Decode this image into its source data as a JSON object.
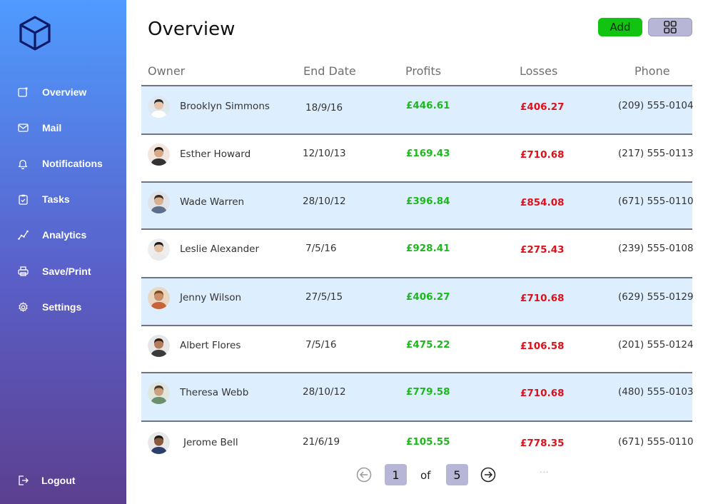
{
  "sidebar": {
    "items": [
      {
        "label": "Overview",
        "icon": "overview-icon"
      },
      {
        "label": "Mail",
        "icon": "mail-icon"
      },
      {
        "label": "Notifications",
        "icon": "bell-icon"
      },
      {
        "label": "Tasks",
        "icon": "clipboard-check-icon"
      },
      {
        "label": "Analytics",
        "icon": "analytics-icon"
      },
      {
        "label": "Save/Print",
        "icon": "printer-icon"
      },
      {
        "label": "Settings",
        "icon": "gear-icon"
      }
    ],
    "logout_label": "Logout"
  },
  "header": {
    "title": "Overview",
    "add_label": "Add"
  },
  "table": {
    "columns": [
      "Owner",
      "End Date",
      "Profits",
      "Losses",
      "Phone"
    ],
    "rows": [
      {
        "owner": "Brooklyn Simmons",
        "end_date": "18/9/16",
        "profit": "£446.61",
        "loss": "£406.27",
        "phone": "(209) 555-0104"
      },
      {
        "owner": "Esther Howard",
        "end_date": "12/10/13",
        "profit": "£169.43",
        "loss": "£710.68",
        "phone": "(217) 555-0113"
      },
      {
        "owner": "Wade Warren",
        "end_date": "28/10/12",
        "profit": "£396.84",
        "loss": "£854.08",
        "phone": "(671) 555-0110"
      },
      {
        "owner": "Leslie Alexander",
        "end_date": "7/5/16",
        "profit": "£928.41",
        "loss": "£275.43",
        "phone": "(239) 555-0108"
      },
      {
        "owner": "Jenny Wilson",
        "end_date": "27/5/15",
        "profit": "£406.27",
        "loss": "£710.68",
        "phone": "(629) 555-0129"
      },
      {
        "owner": "Albert Flores",
        "end_date": "7/5/16",
        "profit": "£475.22",
        "loss": "£106.58",
        "phone": "(201) 555-0124"
      },
      {
        "owner": "Theresa Webb",
        "end_date": "28/10/12",
        "profit": "£779.58",
        "loss": "£710.68",
        "phone": "(480) 555-0103"
      },
      {
        "owner": "Jerome Bell",
        "end_date": "21/6/19",
        "profit": "£105.55",
        "loss": "£778.35",
        "phone": "(671) 555-0110"
      }
    ]
  },
  "pagination": {
    "current": "1",
    "of_label": "of",
    "total": "5",
    "more": "..."
  },
  "colors": {
    "accent_green": "#11c411",
    "profit": "#1cb81c",
    "loss": "#e0101a",
    "row_shade": "#ddeeff",
    "pager": "#b8b6d6"
  }
}
